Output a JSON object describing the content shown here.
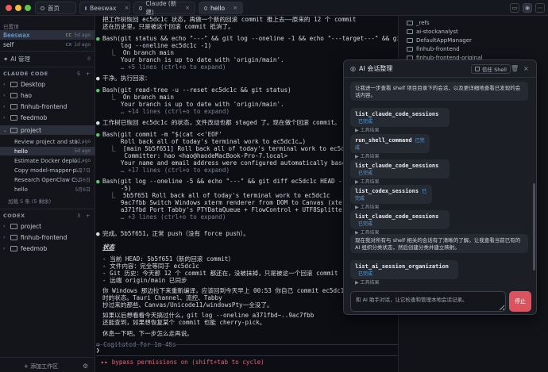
{
  "titlebar": {
    "tabs": [
      {
        "label": "首页",
        "close": ""
      },
      {
        "label": "Beeswax",
        "close": "×"
      },
      {
        "label": "Claude (新建)",
        "close": "×"
      },
      {
        "label": "hello",
        "close": "×"
      }
    ]
  },
  "sidebar": {
    "pinned_label": "已置顶",
    "pinned": [
      {
        "name": "Beeswax",
        "badge": "CC",
        "time": "5d ago"
      },
      {
        "name": "self",
        "badge": "CX",
        "time": "1d ago"
      }
    ],
    "ai_manager": "AI 管理",
    "ai_count": "0",
    "claude_section": "CLAUDE CODE",
    "claude_count": "5",
    "claude_folders": [
      "Desktop",
      "hao",
      "finhub-frontend",
      "feedmob",
      "project"
    ],
    "project_sessions": [
      {
        "name": "Review project and sta...",
        "time": "4d ago"
      },
      {
        "name": "hello",
        "time": "5d ago"
      },
      {
        "name": "Estimate Docker deplo...",
        "time": "6d ago"
      },
      {
        "name": "Copy model-mapper-p...",
        "time": "5月7日"
      },
      {
        "name": "Research OpenClaw C...",
        "time": "5月6日"
      },
      {
        "name": "hello",
        "time": "5月6日"
      }
    ],
    "load_more": "加载 5 条 (5 剩余)",
    "codex_section": "CODEX",
    "codex_count": "3",
    "codex_folders": [
      "project",
      "finhub-frontend",
      "feedmob"
    ],
    "add_workspace": "+ 添加工作区"
  },
  "terminal": {
    "lines": [
      "把工作树恢回 ec5dc1c 状态，再做一个新的回滚 commit 推上去——原来的 12 个 commit",
      "还在历史里，只是被这个回滚 commit 抵消了。",
      "Bash(git status && echo \"---\" && git log --oneline -1 && echo \"---target---\" && git",
      "     log --oneline ec5dc1c -1)",
      "  ⎿  On branch main",
      "     Your branch is up to date with 'origin/main'.",
      "     … +5 lines (ctrl+o to expand)",
      "干净。执行回滚：",
      "Bash(git read-tree -u --reset ec5dc1c && git status)",
      "  ⎿  On branch main",
      "     Your branch is up to date with 'origin/main'.",
      "     … +14 lines (ctrl+o to expand)",
      "工作树已恢回 ec5dc1c 的状态，文件改动也都 staged 了。现在做个回滚 commit。",
      "Bash(git commit -m \"$(cat <<'EOF'",
      "     Roll back all of today's terminal work to ec5dc1c…)",
      "  ⎿  [main 5b5f651] Roll back all of today's terminal work to ec5dc1c",
      "      Committer: hao <hao@haodeMacBook-Pro-7.local>",
      "     Your name and email address were configured automatically based",
      "     … +17 lines (ctrl+o to expand)",
      "Bash(git log --oneline -5 && echo \"---\" && git diff ec5dc1c HEAD --stat 2>",
      "     -5)",
      "  ⎿  5b5f651 Roll back all of today's terminal work to ec5dc1c",
      "     9ac7fbb Switch Windows xterm renderer from DOM to Canvas (xterm-addon-c",
      "     a371fbd Port Tabby's PTYDataQueue + FlowControl + UTF8Splitter (Windows",
      "     … +3 lines (ctrl+o to expand)",
      "完成。5b5f651，正常 push（没有 force push）。",
      "状态",
      "- 当前 HEAD: 5b5f651（新的回滚 commit）",
      "- 文件内容：完全等同于 ec5dc1c",
      "- Git 历史：今天那 12 个 commit 都还在，没被抹掉，只是被这一个回滚 commit",
      "- 远端 origin/main 已同步",
      "你 Windows 那边拉下来重新编译，应该回到今天早上 00:53 你自己 commit ec5dc1c",
      "时的状态。Tauri Channel、流控、Tabby",
      "抄过来的那些、Canvas/Unicode11/windowsPty一全没了。",
      "如果以后想看看今天搞过什么，git log --oneline a371fbd~..9ac7fbb",
      "还能查到，如果想恢复某个 commit 也能 cherry-pick。",
      "休息一下吧。下一步怎么走再说。",
      "✻ Cogitated for 1m 46s",
      "❯",
      "▸▸ bypass permissions on (shift+tab to cycle)"
    ]
  },
  "filetree": {
    "items": [
      "_refs",
      "ai-stockanalyst",
      "DefaultAppManager",
      "finhub-frontend",
      "finhub-frontend-original"
    ]
  },
  "ai_panel": {
    "title": "AI 会话整理",
    "shell_btn": "信任 Shell",
    "intro": "让我进一步查看 shelf 项目目录下的会话，以及更详细地查看已发现的会话内容。",
    "tools": [
      {
        "name": "list_claude_code_sessions",
        "status": "已完成",
        "sub": "▶ 工具结果"
      },
      {
        "name": "run_shell_command",
        "status": "已完成",
        "sub": "▶ 工具结果"
      },
      {
        "name": "list_claude_code_sessions",
        "status": "已完成",
        "sub": "▶ 工具结果"
      },
      {
        "name": "list_codex_sessions",
        "status": "已完成",
        "sub": "▶ 工具结果"
      },
      {
        "name": "list_claude_code_sessions",
        "status": "已完成",
        "sub": "▶ 工具结果"
      }
    ],
    "summary": "现在我对所有与 shelf 相关的会话有了清晰的了解。让我查看当前已有的 AI 组织分类状态，然后创建分类并建立映射。",
    "last_tool": {
      "name": "list_ai_session_organization",
      "status": "已完成",
      "sub": "▶ 工具结果"
    },
    "input_placeholder": "和 AI 助手对话，让它检查和管理本地会话记录。",
    "stop": "停止"
  }
}
